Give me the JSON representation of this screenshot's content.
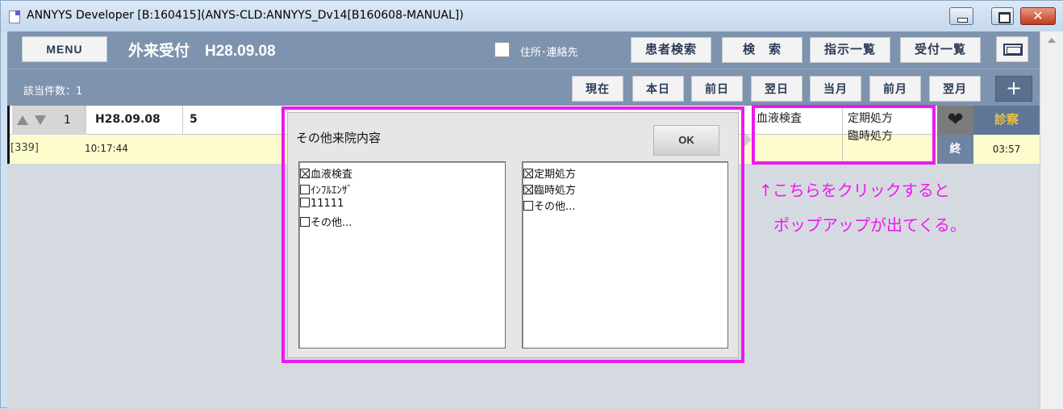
{
  "window": {
    "title": "ANNYYS Developer [B:160415](ANYS-CLD:ANNYYS_Dv14[B160608-MANUAL])",
    "close_glyph": "✕"
  },
  "toolbar": {
    "menu_label": "MENU",
    "page_title": "外来受付　H28.09.08",
    "address_checkbox_checked": false,
    "address_label": "住所･連絡先",
    "patient_search": "患者検索",
    "search": "検　索",
    "orders_list": "指示一覧",
    "reception_list": "受付一覧",
    "screen_icon": "window-icon"
  },
  "navbar": {
    "count_label": "該当件数：1",
    "now": "現在",
    "today": "本日",
    "prev_day": "前日",
    "next_day": "翌日",
    "this_month": "当月",
    "prev_month": "前月",
    "next_month": "翌月",
    "plus": "+"
  },
  "row": {
    "number": "1",
    "date": "H28.09.08",
    "col3": "5",
    "patient_id": "[339]",
    "time": "10:17:44",
    "exam": "血液検査",
    "rx_lines": [
      "定期処方",
      "臨時処方"
    ],
    "heart_icon": "heart-icon",
    "heart_glyph": "❤",
    "end_label": "終",
    "status_label": "診察",
    "elapsed": "03:57"
  },
  "popup": {
    "title": "その他来院内容",
    "ok_label": "OK",
    "left_options": [
      {
        "label": "血液検査",
        "checked": true
      },
      {
        "label": "ｲﾝﾌﾙｴﾝｻﾞ",
        "checked": false
      },
      {
        "label": "11111",
        "checked": false
      },
      {
        "label": "その他...",
        "checked": false
      }
    ],
    "right_options": [
      {
        "label": "定期処方",
        "checked": true
      },
      {
        "label": "臨時処方",
        "checked": true
      },
      {
        "label": "その他...",
        "checked": false
      }
    ]
  },
  "annotation": {
    "line1": "↑こちらをクリックすると",
    "line2": "ポップアップが出てくる。",
    "color": "#ee18f0"
  }
}
